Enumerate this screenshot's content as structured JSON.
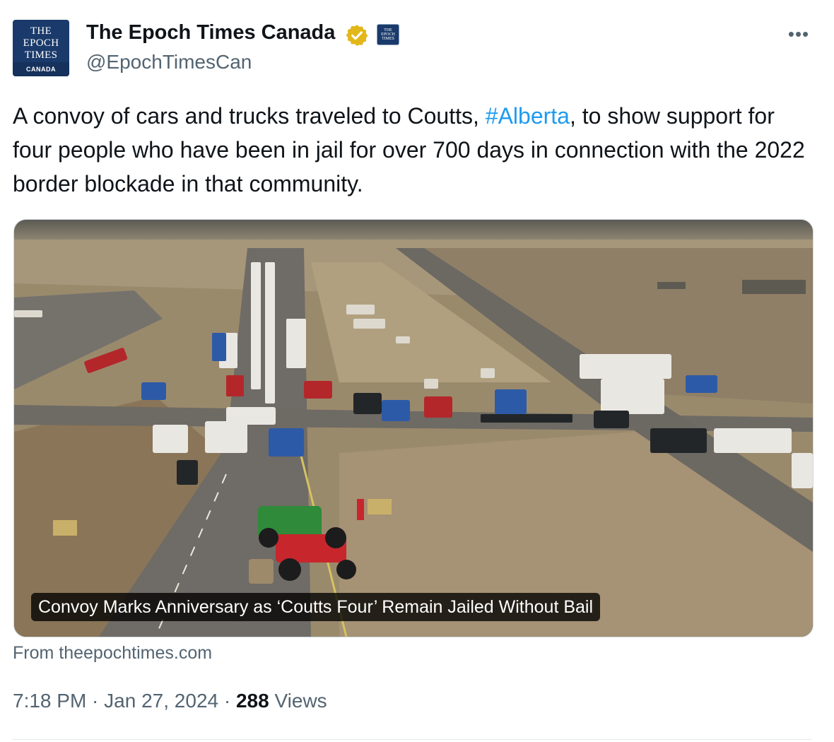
{
  "header": {
    "avatar": {
      "line1": "THE",
      "line2": "EPOCH",
      "line3": "TIMES",
      "band": "CANADA"
    },
    "display_name": "The Epoch Times Canada",
    "handle": "@EpochTimesCan",
    "verified_icon": "verified-badge-gold-icon",
    "affiliate_logo": {
      "line1": "THE",
      "line2": "EPOCH",
      "line3": "TIMES"
    },
    "more_label": "•••"
  },
  "tweet": {
    "text_before": "A convoy of cars and trucks traveled to Coutts, ",
    "hashtag": "#Alberta",
    "text_after": ", to show support for four people who have been in jail for over 700 days in connection with the 2022 border blockade in that community."
  },
  "card": {
    "image_description_icon": "aerial-photo-convoy-highway",
    "caption": "Convoy Marks Anniversary as ‘Coutts Four’ Remain Jailed Without Bail",
    "source": "From theepochtimes.com"
  },
  "meta": {
    "time": "7:18 PM",
    "separator": " · ",
    "date": "Jan 27, 2024",
    "views_count": "288",
    "views_label": "Views"
  },
  "colors": {
    "link": "#1d9bf0",
    "secondary_text": "#536471",
    "primary_text": "#0f1419",
    "brand_navy": "#1a3a6b",
    "verified_gold": "#e2b719"
  }
}
